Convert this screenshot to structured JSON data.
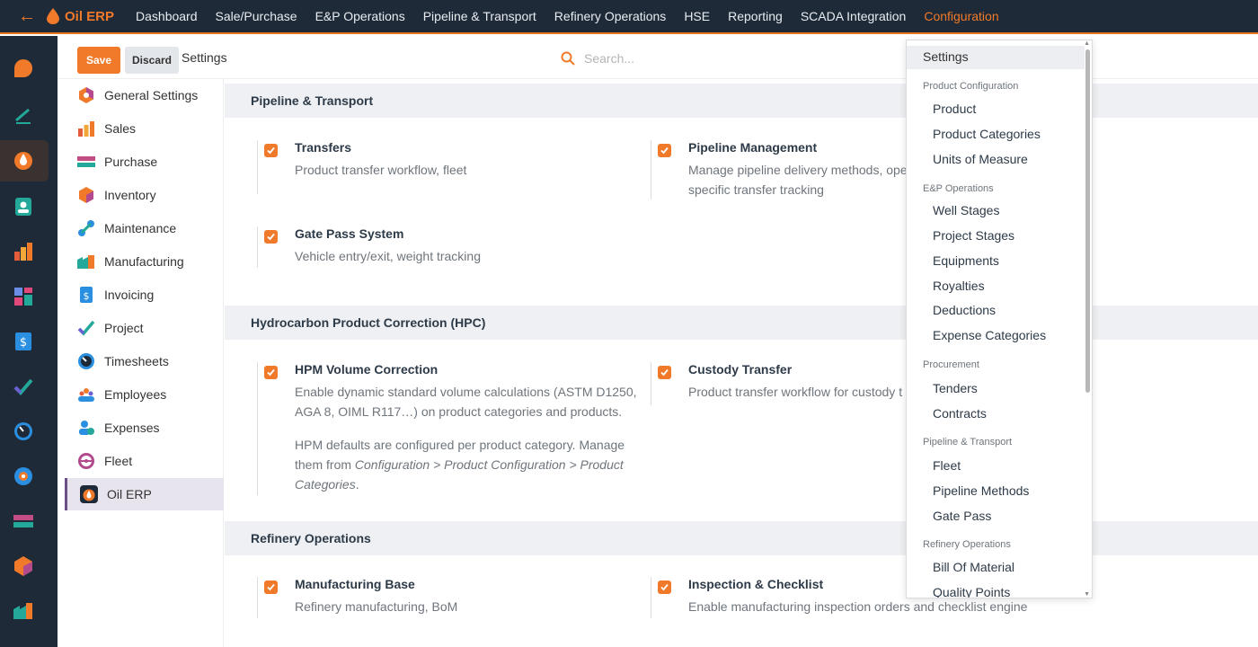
{
  "app": {
    "name": "Oil ERP",
    "back_label": "←"
  },
  "nav": {
    "items": [
      {
        "label": "Dashboard"
      },
      {
        "label": "Sale/Purchase"
      },
      {
        "label": "E&P Operations"
      },
      {
        "label": "Pipeline & Transport"
      },
      {
        "label": "Refinery Operations"
      },
      {
        "label": "HSE"
      },
      {
        "label": "Reporting"
      },
      {
        "label": "SCADA Integration"
      },
      {
        "label": "Configuration",
        "active": true
      }
    ]
  },
  "controlbar": {
    "save_label": "Save",
    "discard_label": "Discard",
    "breadcrumb": "Settings",
    "search_placeholder": "Search..."
  },
  "settings_nav": {
    "items": [
      {
        "label": "General Settings",
        "icon": "general-settings-icon"
      },
      {
        "label": "Sales",
        "icon": "sales-icon"
      },
      {
        "label": "Purchase",
        "icon": "purchase-icon"
      },
      {
        "label": "Inventory",
        "icon": "inventory-icon"
      },
      {
        "label": "Maintenance",
        "icon": "maintenance-icon"
      },
      {
        "label": "Manufacturing",
        "icon": "manufacturing-icon"
      },
      {
        "label": "Invoicing",
        "icon": "invoicing-icon"
      },
      {
        "label": "Project",
        "icon": "project-icon"
      },
      {
        "label": "Timesheets",
        "icon": "timesheets-icon"
      },
      {
        "label": "Employees",
        "icon": "employees-icon"
      },
      {
        "label": "Expenses",
        "icon": "expenses-icon"
      },
      {
        "label": "Fleet",
        "icon": "fleet-icon"
      },
      {
        "label": "Oil ERP",
        "icon": "oil-erp-icon",
        "active": true
      }
    ]
  },
  "sections": {
    "pipeline": {
      "title": "Pipeline & Transport",
      "transfers": {
        "title": "Transfers",
        "desc": "Product transfer workflow, fleet",
        "checked": true
      },
      "pipeline_mgmt": {
        "title": "Pipeline Management",
        "desc1": "Manage pipeline delivery methods, oper",
        "desc2": "specific transfer tracking",
        "checked": true
      },
      "gate_pass": {
        "title": "Gate Pass System",
        "desc": "Vehicle entry/exit, weight tracking",
        "checked": true
      }
    },
    "hpc": {
      "title": "Hydrocarbon Product Correction (HPC)",
      "hpm": {
        "title": "HPM Volume Correction",
        "desc1": "Enable dynamic standard volume calculations (ASTM D1250,",
        "desc2": "AGA 8, OIML R117…) on product categories and products.",
        "note1": "HPM defaults are configured per product category. Manage",
        "note2_prefix": "them from ",
        "note2_italic": "Configuration > Product Configuration > Product",
        "note3_italic": "Categories",
        "note3_suffix": ".",
        "checked": true
      },
      "custody": {
        "title": "Custody Transfer",
        "desc": "Product transfer workflow for custody t",
        "checked": true
      }
    },
    "refinery": {
      "title": "Refinery Operations",
      "manufacturing": {
        "title": "Manufacturing Base",
        "desc": "Refinery manufacturing, BoM",
        "checked": true
      },
      "inspection": {
        "title": "Inspection & Checklist",
        "desc": "Enable manufacturing inspection orders and checklist engine",
        "checked": true
      }
    }
  },
  "dropdown": {
    "first": "Settings",
    "groups": [
      {
        "header": "Product Configuration",
        "items": [
          "Product",
          "Product Categories",
          "Units of Measure"
        ]
      },
      {
        "header": "E&P Operations",
        "items": [
          "Well Stages",
          "Project Stages",
          "Equipments",
          "Royalties",
          "Deductions",
          "Expense Categories"
        ]
      },
      {
        "header": "Procurement",
        "items": [
          "Tenders",
          "Contracts"
        ]
      },
      {
        "header": "Pipeline & Transport",
        "items": [
          "Fleet",
          "Pipeline Methods",
          "Gate Pass"
        ]
      },
      {
        "header": "Refinery Operations",
        "items": [
          "Bill Of Material",
          "Quality Points"
        ]
      }
    ]
  },
  "colors": {
    "accent": "#f07a2a",
    "topbar": "#1e2a38",
    "section_bg": "#eef0f3"
  }
}
